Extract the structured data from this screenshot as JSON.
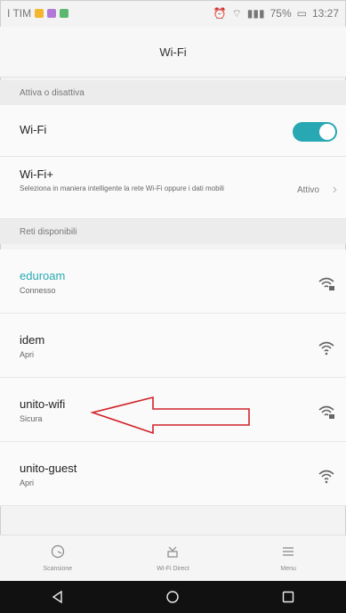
{
  "status": {
    "carrier": "I TIM",
    "battery": "75%",
    "time": "13:27"
  },
  "header": {
    "title": "Wi-Fi"
  },
  "sections": {
    "toggle_header": "Attiva o disattiva",
    "networks_header": "Reti disponibili"
  },
  "wifi_row": {
    "label": "Wi-Fi",
    "enabled": true
  },
  "wifi_plus": {
    "label": "Wi-Fi+",
    "description": "Seleziona in maniera intelligente la rete Wi-Fi oppure i dati mobili",
    "status": "Attivo"
  },
  "networks": [
    {
      "name": "eduroam",
      "status": "Connesso",
      "secure": true
    },
    {
      "name": "idem",
      "status": "Apri",
      "secure": false
    },
    {
      "name": "unito-wifi",
      "status": "Sicura",
      "secure": true
    },
    {
      "name": "unito-guest",
      "status": "Apri",
      "secure": false
    }
  ],
  "bottom_nav": {
    "scan": "Scansione",
    "direct": "Wi-Fi Direct",
    "menu": "Menu"
  },
  "colors": {
    "accent": "#27a8b3",
    "arrow": "#d0242a"
  }
}
